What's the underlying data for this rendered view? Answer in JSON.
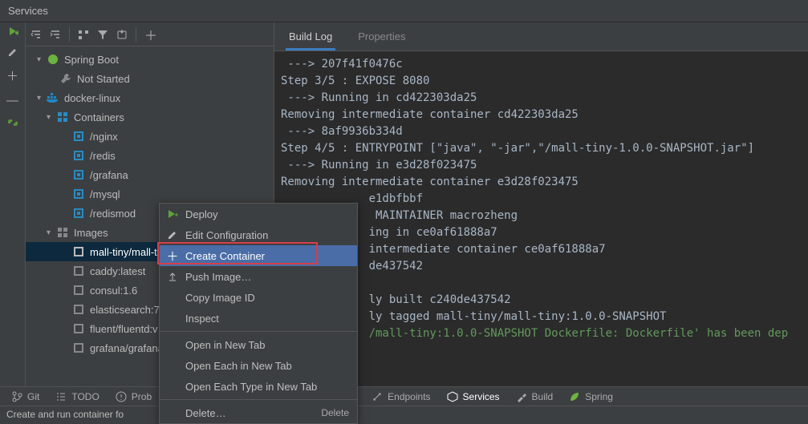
{
  "title": "Services",
  "toolbar": {
    "expand": "expand",
    "collapse": "collapse",
    "group": "group",
    "filter": "filter",
    "pin": "pin",
    "add": "add"
  },
  "tree": {
    "spring": "Spring Boot",
    "not_started": "Not Started",
    "host": "docker-linux",
    "containers_label": "Containers",
    "containers": [
      "/nginx",
      "/redis",
      "/grafana",
      "/mysql",
      "/redismod"
    ],
    "images_label": "Images",
    "images": [
      "mall-tiny/mall-t",
      "caddy:latest",
      "consul:1.6",
      "elasticsearch:7.",
      "fluent/fluentd:v",
      "grafana/grafana"
    ]
  },
  "tabs": {
    "buildlog": "Build Log",
    "properties": "Properties"
  },
  "log_lines": [
    " ---> 207f41f0476c",
    "Step 3/5 : EXPOSE 8080",
    " ---> Running in cd422303da25",
    "Removing intermediate container cd422303da25",
    " ---> 8af9936b334d",
    "Step 4/5 : ENTRYPOINT [\"java\", \"-jar\",\"/mall-tiny-1.0.0-SNAPSHOT.jar\"]",
    " ---> Running in e3d28f023475",
    "Removing intermediate container e3d28f023475",
    "             e1dbfbbf",
    "              MAINTAINER macrozheng",
    "             ing in ce0af61888a7",
    "             intermediate container ce0af61888a7",
    "             de437542",
    "",
    "             ly built c240de437542",
    "             ly tagged mall-tiny/mall-tiny:1.0.0-SNAPSHOT"
  ],
  "log_success": "             /mall-tiny:1.0.0-SNAPSHOT Dockerfile: Dockerfile' has been dep",
  "ctx": {
    "deploy": "Deploy",
    "edit": "Edit Configuration",
    "create": "Create Container",
    "push": "Push Image…",
    "copy": "Copy Image ID",
    "inspect": "Inspect",
    "open_new": "Open in New Tab",
    "open_each": "Open Each in New Tab",
    "open_type": "Open Each Type in New Tab",
    "delete": "Delete…",
    "delete_hint": "Delete"
  },
  "bottom": {
    "git": "Git",
    "todo": "TODO",
    "problems": "Prob",
    "endpoints": "Endpoints",
    "services": "Services",
    "build": "Build",
    "spring": "Spring"
  },
  "status": "Create and run container fo"
}
